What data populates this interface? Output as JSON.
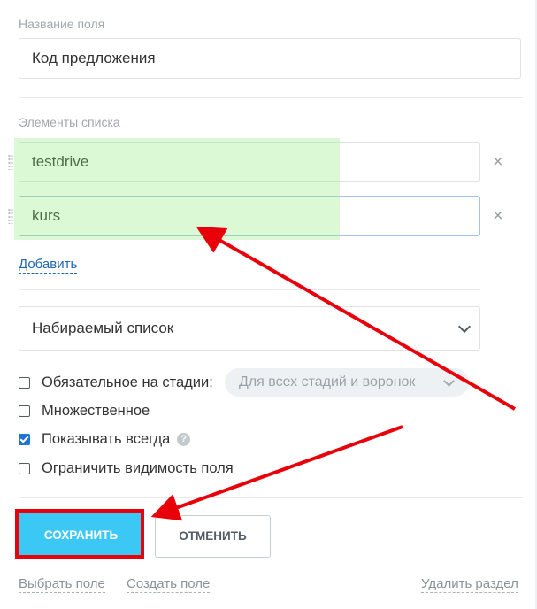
{
  "field_name": {
    "label": "Название поля",
    "value": "Код предложения"
  },
  "list": {
    "label": "Элементы списка",
    "items": [
      {
        "value": "testdrive"
      },
      {
        "value": "kurs"
      }
    ],
    "remove_symbol": "×",
    "add_link": "Добавить"
  },
  "list_type": {
    "selected": "Набираемый список"
  },
  "options": [
    {
      "label": "Обязательное на стадии:",
      "checked": false
    },
    {
      "label": "Множественное",
      "checked": false
    },
    {
      "label": "Показывать всегда",
      "checked": true
    },
    {
      "label": "Ограничить видимость поля",
      "checked": false
    }
  ],
  "stage_select": {
    "value": "Для всех стадий и воронок"
  },
  "help_symbol": "?",
  "buttons": {
    "save": "СОХРАНИТЬ",
    "cancel": "ОТМЕНИТЬ"
  },
  "footer": {
    "select_field": "Выбрать поле",
    "create_field": "Создать поле",
    "delete_section": "Удалить раздел"
  },
  "colors": {
    "save_button": "#3bc8f5",
    "annotation_red": "#e8000b",
    "highlight_green": "#8ceb78",
    "link_blue": "#2067b0"
  },
  "icons": [
    "drag-handle-icon",
    "close-icon",
    "chevron-down-icon",
    "help-icon",
    "checkbox-icon"
  ]
}
